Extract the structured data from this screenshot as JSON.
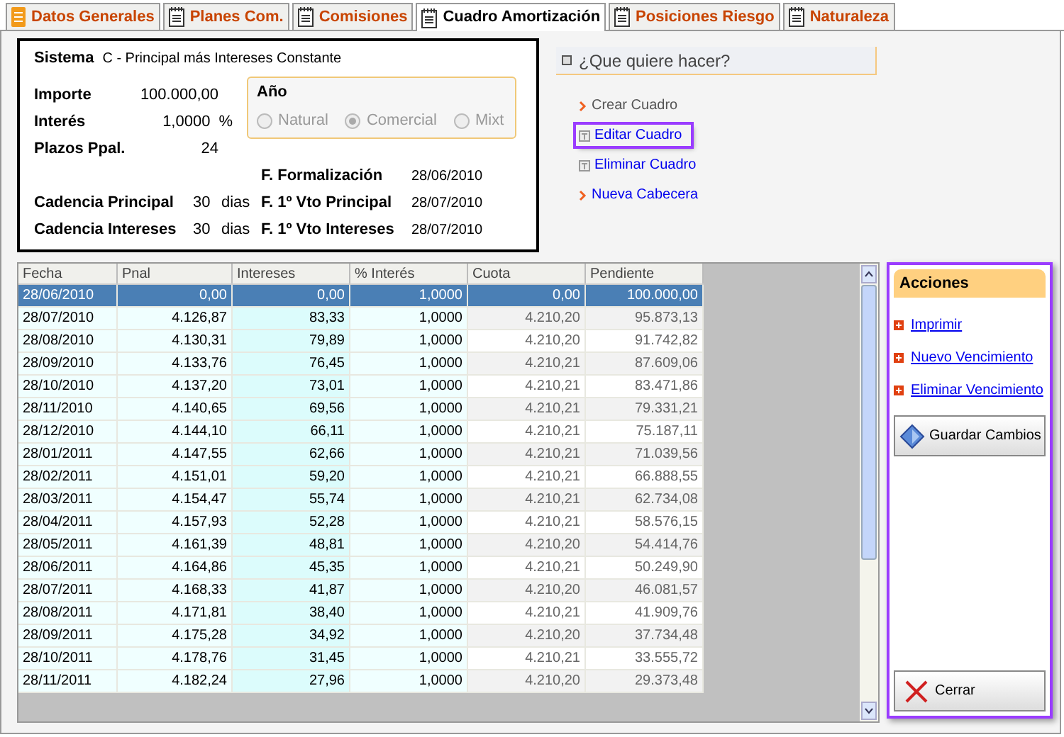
{
  "tabs": [
    {
      "label": "Datos Generales",
      "selected": false
    },
    {
      "label": "Planes Com.",
      "selected": false
    },
    {
      "label": "Comisiones",
      "selected": false
    },
    {
      "label": "Cuadro Amortización",
      "selected": true
    },
    {
      "label": "Posiciones Riesgo",
      "selected": false
    },
    {
      "label": "Naturaleza",
      "selected": false
    }
  ],
  "info": {
    "sistema_label": "Sistema",
    "sistema_value": "C - Principal más Intereses Constante",
    "importe_label": "Importe",
    "importe_value": "100.000,00",
    "interes_label": "Interés",
    "interes_value": "1,0000",
    "interes_unit": "%",
    "plazos_label": "Plazos Ppal.",
    "plazos_value": "24",
    "anio": {
      "title": "Año",
      "options": [
        {
          "label": "Natural",
          "selected": false
        },
        {
          "label": "Comercial",
          "selected": true
        },
        {
          "label": "Mixt",
          "selected": false
        }
      ]
    },
    "dates": [
      {
        "label": "F. Formalización",
        "value": "28/06/2010"
      },
      {
        "label": "F. 1º Vto Principal",
        "value": "28/07/2010"
      },
      {
        "label": "F. 1º Vto Intereses",
        "value": "28/07/2010"
      }
    ],
    "cadencias": [
      {
        "label": "Cadencia Principal",
        "value": "30",
        "unit": "dias"
      },
      {
        "label": "Cadencia Intereses",
        "value": "30",
        "unit": "dias"
      }
    ]
  },
  "actions": {
    "title": "¿Que quiere hacer?",
    "items": [
      {
        "label": "Crear Cuadro",
        "kind": "arrow",
        "disabled": true,
        "highlighted": false
      },
      {
        "label": "Editar Cuadro",
        "kind": "doc",
        "disabled": false,
        "highlighted": true
      },
      {
        "label": "Eliminar Cuadro",
        "kind": "doc",
        "disabled": false,
        "highlighted": false
      },
      {
        "label": "Nueva Cabecera",
        "kind": "arrow",
        "disabled": false,
        "highlighted": false
      }
    ]
  },
  "table": {
    "columns": [
      "Fecha",
      "Pnal",
      "Intereses",
      "% Interés",
      "Cuota",
      "Pendiente"
    ],
    "rows": [
      {
        "cells": [
          "28/06/2010",
          "0,00",
          "0,00",
          "1,0000",
          "0,00",
          "100.000,00"
        ],
        "selected": true
      },
      {
        "cells": [
          "28/07/2010",
          "4.126,87",
          "83,33",
          "1,0000",
          "4.210,20",
          "95.873,13"
        ],
        "selected": false
      },
      {
        "cells": [
          "28/08/2010",
          "4.130,31",
          "79,89",
          "1,0000",
          "4.210,20",
          "91.742,82"
        ],
        "selected": false
      },
      {
        "cells": [
          "28/09/2010",
          "4.133,76",
          "76,45",
          "1,0000",
          "4.210,21",
          "87.609,06"
        ],
        "selected": false
      },
      {
        "cells": [
          "28/10/2010",
          "4.137,20",
          "73,01",
          "1,0000",
          "4.210,21",
          "83.471,86"
        ],
        "selected": false
      },
      {
        "cells": [
          "28/11/2010",
          "4.140,65",
          "69,56",
          "1,0000",
          "4.210,21",
          "79.331,21"
        ],
        "selected": false
      },
      {
        "cells": [
          "28/12/2010",
          "4.144,10",
          "66,11",
          "1,0000",
          "4.210,21",
          "75.187,11"
        ],
        "selected": false
      },
      {
        "cells": [
          "28/01/2011",
          "4.147,55",
          "62,66",
          "1,0000",
          "4.210,21",
          "71.039,56"
        ],
        "selected": false
      },
      {
        "cells": [
          "28/02/2011",
          "4.151,01",
          "59,20",
          "1,0000",
          "4.210,21",
          "66.888,55"
        ],
        "selected": false
      },
      {
        "cells": [
          "28/03/2011",
          "4.154,47",
          "55,74",
          "1,0000",
          "4.210,21",
          "62.734,08"
        ],
        "selected": false
      },
      {
        "cells": [
          "28/04/2011",
          "4.157,93",
          "52,28",
          "1,0000",
          "4.210,21",
          "58.576,15"
        ],
        "selected": false
      },
      {
        "cells": [
          "28/05/2011",
          "4.161,39",
          "48,81",
          "1,0000",
          "4.210,20",
          "54.414,76"
        ],
        "selected": false
      },
      {
        "cells": [
          "28/06/2011",
          "4.164,86",
          "45,35",
          "1,0000",
          "4.210,21",
          "50.249,90"
        ],
        "selected": false
      },
      {
        "cells": [
          "28/07/2011",
          "4.168,33",
          "41,87",
          "1,0000",
          "4.210,20",
          "46.081,57"
        ],
        "selected": false
      },
      {
        "cells": [
          "28/08/2011",
          "4.171,81",
          "38,40",
          "1,0000",
          "4.210,21",
          "41.909,76"
        ],
        "selected": false
      },
      {
        "cells": [
          "28/09/2011",
          "4.175,28",
          "34,92",
          "1,0000",
          "4.210,20",
          "37.734,48"
        ],
        "selected": false
      },
      {
        "cells": [
          "28/10/2011",
          "4.178,76",
          "31,45",
          "1,0000",
          "4.210,21",
          "33.555,72"
        ],
        "selected": false
      },
      {
        "cells": [
          "28/11/2011",
          "4.182,24",
          "27,96",
          "1,0000",
          "4.210,20",
          "29.373,48"
        ],
        "selected": false
      }
    ]
  },
  "acciones": {
    "title": "Acciones",
    "highlighted": true,
    "links": [
      "Imprimir",
      "Nuevo Vencimiento",
      "Eliminar Vencimiento"
    ],
    "save_button": "Guardar Cambios",
    "close_button": "Cerrar"
  }
}
